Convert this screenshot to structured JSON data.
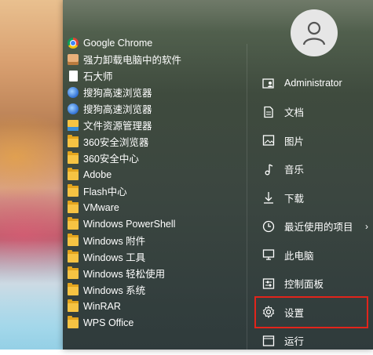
{
  "apps": [
    {
      "label": "Google Chrome",
      "icon": "chrome-icon"
    },
    {
      "label": "强力卸载电脑中的软件",
      "icon": "box-icon"
    },
    {
      "label": "石大师",
      "icon": "document-icon"
    },
    {
      "label": "搜狗高速浏览器",
      "icon": "sogou-browser-icon"
    },
    {
      "label": "搜狗高速浏览器",
      "icon": "sogou-browser-icon"
    },
    {
      "label": "文件资源管理器",
      "icon": "file-explorer-icon"
    },
    {
      "label": "360安全浏览器",
      "icon": "folder-icon"
    },
    {
      "label": "360安全中心",
      "icon": "folder-icon"
    },
    {
      "label": "Adobe",
      "icon": "folder-icon"
    },
    {
      "label": "Flash中心",
      "icon": "folder-icon"
    },
    {
      "label": "VMware",
      "icon": "folder-icon"
    },
    {
      "label": "Windows PowerShell",
      "icon": "folder-icon"
    },
    {
      "label": "Windows 附件",
      "icon": "folder-icon"
    },
    {
      "label": "Windows 工具",
      "icon": "folder-icon"
    },
    {
      "label": "Windows 轻松使用",
      "icon": "folder-icon"
    },
    {
      "label": "Windows 系统",
      "icon": "folder-icon"
    },
    {
      "label": "WinRAR",
      "icon": "folder-icon"
    },
    {
      "label": "WPS Office",
      "icon": "folder-icon"
    }
  ],
  "user": {
    "icon": "user-avatar-icon"
  },
  "right_menu": [
    {
      "label": "Administrator",
      "icon": "user-folder-icon"
    },
    {
      "label": "文档",
      "icon": "document-icon"
    },
    {
      "label": "图片",
      "icon": "picture-icon"
    },
    {
      "label": "音乐",
      "icon": "music-icon"
    },
    {
      "label": "下载",
      "icon": "download-icon"
    },
    {
      "label": "最近使用的项目",
      "icon": "clock-icon",
      "has_submenu": true
    },
    {
      "label": "此电脑",
      "icon": "computer-icon"
    },
    {
      "label": "控制面板",
      "icon": "control-panel-icon"
    },
    {
      "label": "设置",
      "icon": "gear-icon",
      "highlighted": true
    },
    {
      "label": "运行",
      "icon": "run-icon"
    }
  ],
  "highlight_color": "#e2241b"
}
